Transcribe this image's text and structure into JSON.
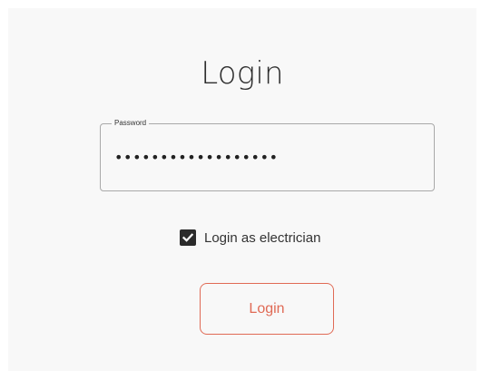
{
  "login_form": {
    "title": "Login",
    "password_field": {
      "label": "Password",
      "value": "••••••••••••••••••"
    },
    "electrician_checkbox": {
      "label": "Login as electrician",
      "checked": true
    },
    "submit_label": "Login"
  },
  "colors": {
    "panel_background": "#f8f8f8",
    "accent": "#e06a55",
    "checkbox_fill": "#2b2b2b"
  }
}
